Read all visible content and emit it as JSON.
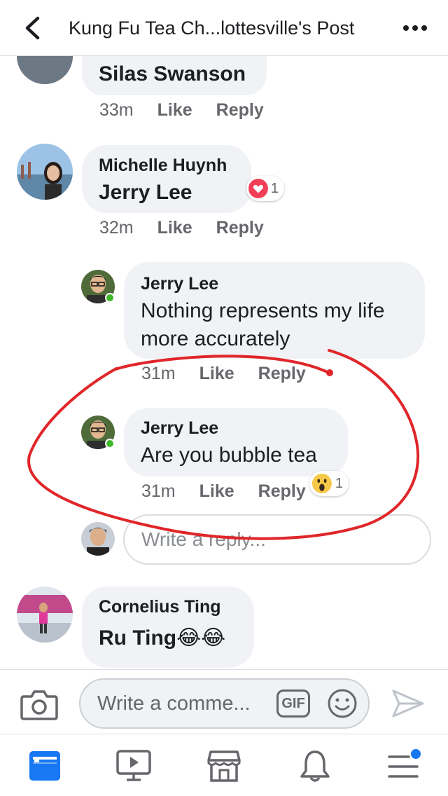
{
  "header": {
    "title": "Kung Fu Tea Ch...lottesville's Post",
    "back_icon": "chevron-left-icon",
    "more_icon": "more-horizontal-icon"
  },
  "comments": [
    {
      "author": "",
      "text": "Silas Swanson",
      "time": "33m",
      "like": "Like",
      "reply": "Reply"
    },
    {
      "author": "Michelle Huynh",
      "text": "Jerry Lee",
      "time": "32m",
      "like": "Like",
      "reply": "Reply",
      "reaction": {
        "icon": "heart-icon",
        "count": "1",
        "color": "#f33e58"
      }
    },
    {
      "author": "Jerry Lee",
      "text": "Nothing represents my life more accurately",
      "time": "31m",
      "like": "Like",
      "reply": "Reply"
    },
    {
      "author": "Jerry Lee",
      "text": "Are you bubble tea",
      "time": "31m",
      "like": "Like",
      "reply": "Reply",
      "reaction": {
        "icon": "wow-icon",
        "count": "1"
      }
    },
    {
      "author": "Cornelius Ting",
      "text": "Ru Ting😂😂"
    }
  ],
  "reply_box": {
    "placeholder": "Write a reply..."
  },
  "composer": {
    "placeholder": "Write a comme...",
    "gif_label": "GIF",
    "camera_icon": "camera-icon",
    "emoji_icon": "smiley-icon",
    "send_icon": "send-icon"
  },
  "bottom_nav": [
    {
      "icon": "news-feed-icon",
      "active": true
    },
    {
      "icon": "watch-video-icon",
      "active": false
    },
    {
      "icon": "marketplace-icon",
      "active": false
    },
    {
      "icon": "bell-icon",
      "active": false
    },
    {
      "icon": "menu-icon",
      "active": false,
      "badge": true
    }
  ],
  "colors": {
    "accent": "#1877f2",
    "bubble": "#f0f2f5",
    "annotation": "#e0262a",
    "online": "#42b72a"
  }
}
